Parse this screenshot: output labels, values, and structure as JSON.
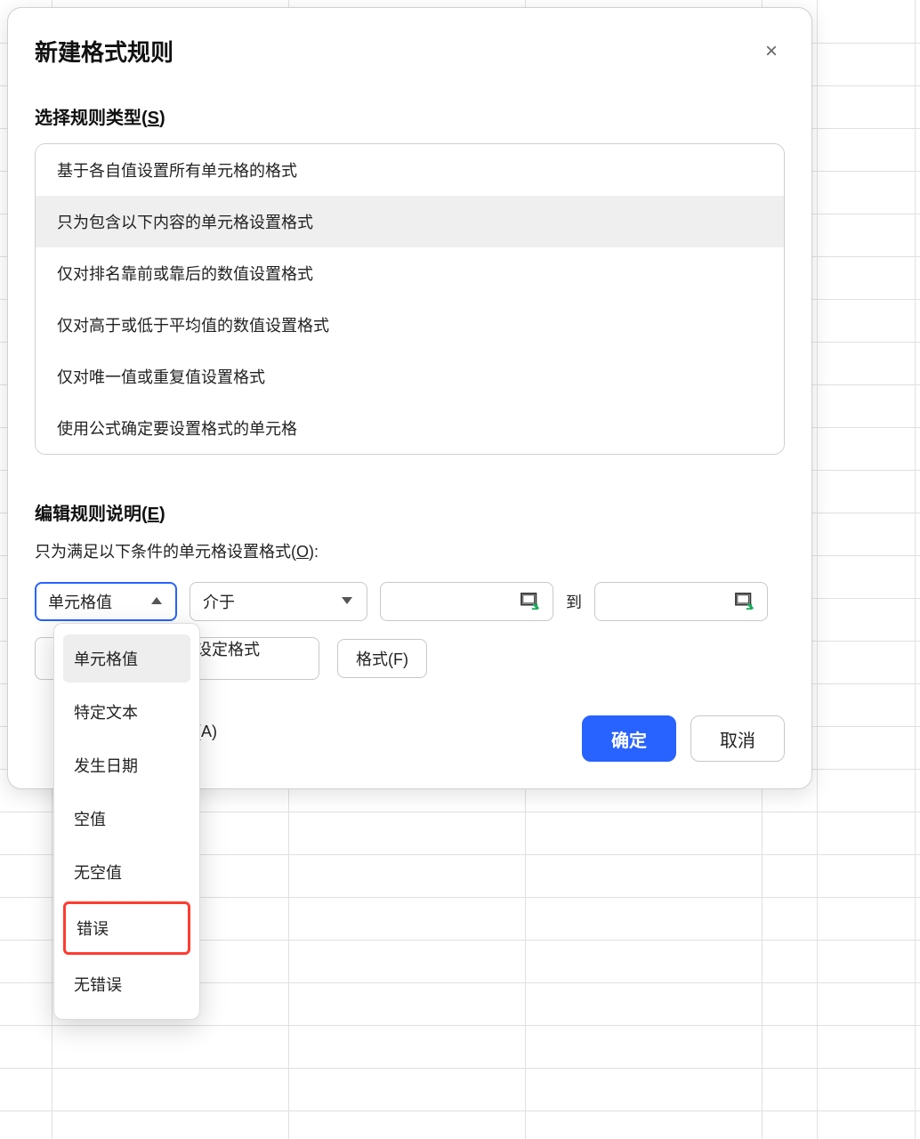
{
  "dialog": {
    "title": "新建格式规则",
    "close": "×"
  },
  "section_rule_type": {
    "label_prefix": "选择规则类型(",
    "label_key": "S",
    "label_suffix": ")"
  },
  "rule_types": [
    "基于各自值设置所有单元格的格式",
    "只为包含以下内容的单元格设置格式",
    "仅对排名靠前或靠后的数值设置格式",
    "仅对高于或低于平均值的数值设置格式",
    "仅对唯一值或重复值设置格式",
    "使用公式确定要设置格式的单元格"
  ],
  "rule_types_selected_index": 1,
  "section_rule_desc": {
    "label_prefix": "编辑规则说明(",
    "label_key": "E",
    "label_suffix": ")"
  },
  "condition": {
    "label_prefix": "只为满足以下条件的单元格设置格式(",
    "label_key": "O",
    "label_suffix": "):"
  },
  "select1": {
    "value": "单元格值"
  },
  "select2": {
    "value": "介于"
  },
  "input1": {
    "value": ""
  },
  "between": "到",
  "input2": {
    "value": ""
  },
  "format_preview_partial": "设定格式",
  "format_button": "格式(F)",
  "footer_left_partial": "(A)",
  "ok": "确定",
  "cancel": "取消",
  "dropdown": {
    "items": [
      "单元格值",
      "特定文本",
      "发生日期",
      "空值",
      "无空值",
      "错误",
      "无错误"
    ],
    "selected_index": 0,
    "highlight_index": 5
  }
}
